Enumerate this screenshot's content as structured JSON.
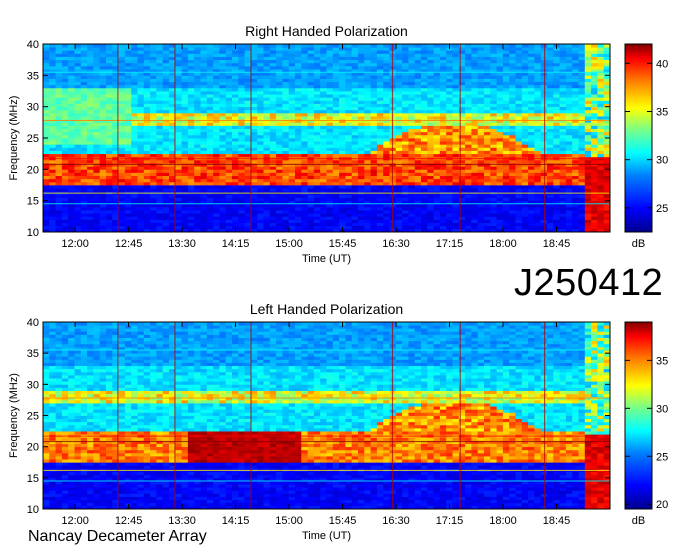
{
  "observation_id": "J250412",
  "footer": "Nancay Decameter Array",
  "chart_data": [
    {
      "type": "heatmap",
      "title": "Right Handed Polarization",
      "xlabel": "Time (UT)",
      "ylabel": "Frequency (MHz)",
      "x_ticks": [
        "12:00",
        "12:45",
        "13:30",
        "14:15",
        "15:00",
        "15:45",
        "16:30",
        "17:15",
        "18:00",
        "18:45"
      ],
      "x_range": [
        "11:33",
        "19:30"
      ],
      "y_ticks": [
        10,
        15,
        20,
        25,
        30,
        35,
        40
      ],
      "ylim": [
        10,
        40
      ],
      "colorbar": {
        "label": "dB",
        "ticks": [
          25,
          30,
          35,
          40
        ],
        "range": [
          22.5,
          42
        ]
      },
      "colormap": [
        "#00008f",
        "#0000ff",
        "#0080ff",
        "#00ffff",
        "#80ff80",
        "#ffff00",
        "#ff8000",
        "#ff0000",
        "#800000"
      ]
    },
    {
      "type": "heatmap",
      "title": "Left Handed Polarization",
      "xlabel": "Time (UT)",
      "ylabel": "Frequency (MHz)",
      "x_ticks": [
        "12:00",
        "12:45",
        "13:30",
        "14:15",
        "15:00",
        "15:45",
        "16:30",
        "17:15",
        "18:00",
        "18:45"
      ],
      "x_range": [
        "11:33",
        "19:30"
      ],
      "y_ticks": [
        10,
        15,
        20,
        25,
        30,
        35,
        40
      ],
      "ylim": [
        10,
        40
      ],
      "colorbar": {
        "label": "dB",
        "ticks": [
          20,
          25,
          30,
          35
        ],
        "range": [
          19.5,
          39
        ]
      },
      "colormap": [
        "#00008f",
        "#0000ff",
        "#0080ff",
        "#00ffff",
        "#80ff80",
        "#ffff00",
        "#ff8000",
        "#ff0000",
        "#800000"
      ]
    }
  ]
}
